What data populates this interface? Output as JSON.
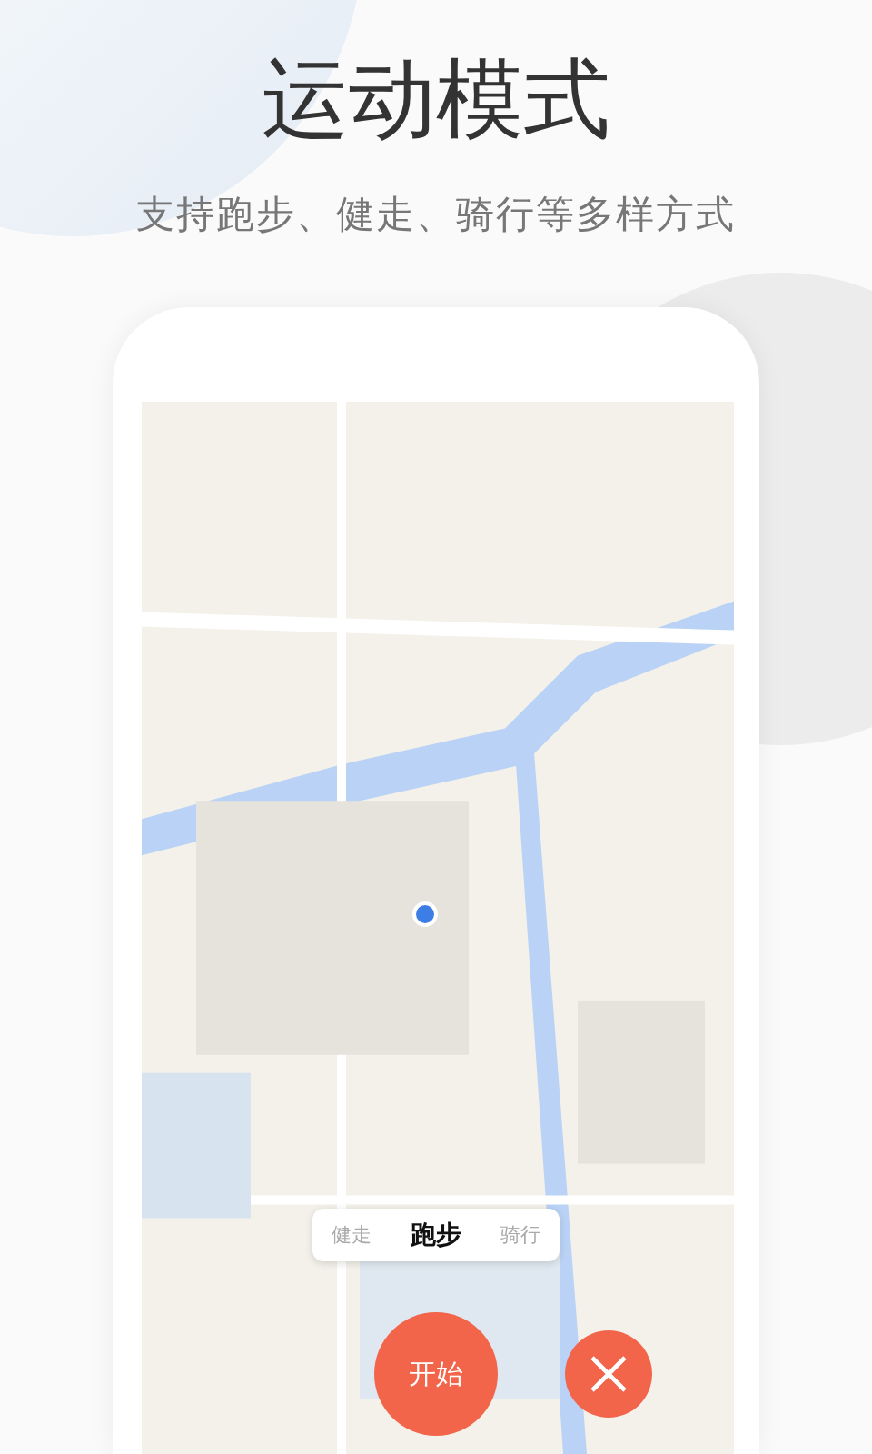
{
  "header": {
    "title": "运动模式",
    "subtitle": "支持跑步、健走、骑行等多样方式"
  },
  "modes": [
    {
      "label": "健走",
      "selected": false
    },
    {
      "label": "跑步",
      "selected": true
    },
    {
      "label": "骑行",
      "selected": false
    }
  ],
  "start_button": {
    "label": "开始"
  }
}
